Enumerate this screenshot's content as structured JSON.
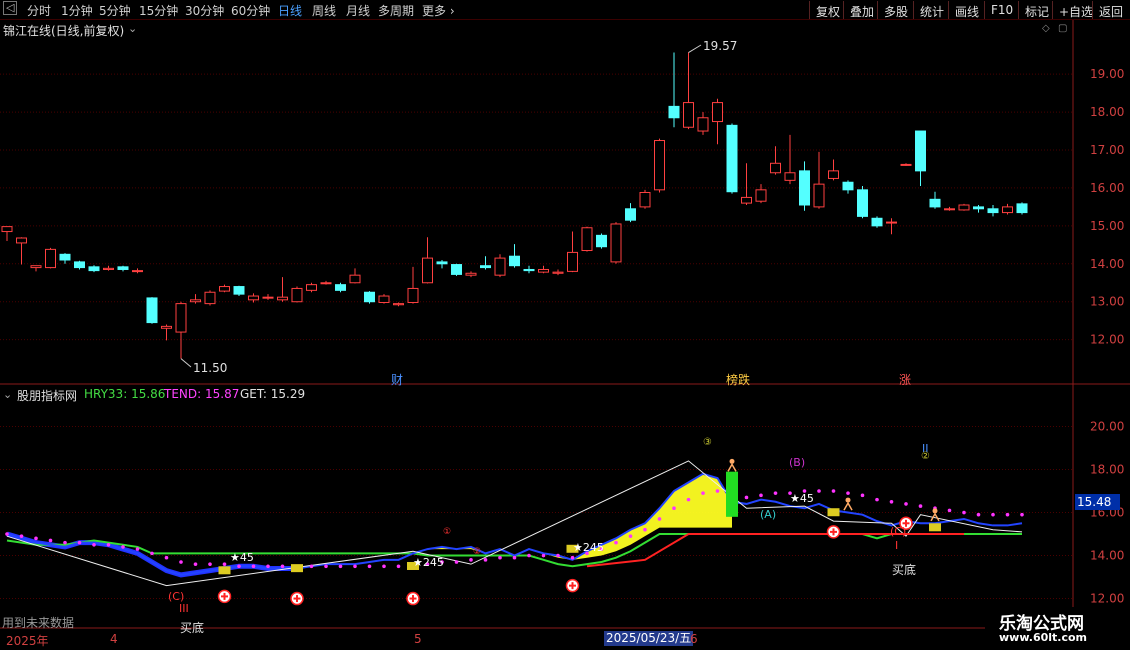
{
  "toolbar": {
    "left_items": [
      "分时",
      "1分钟",
      "5分钟",
      "15分钟",
      "30分钟",
      "60分钟",
      "日线",
      "周线",
      "月线",
      "多周期",
      "更多"
    ],
    "active_index": 6,
    "right_items": [
      "复权",
      "叠加",
      "多股",
      "统计",
      "画线",
      "F10",
      "标记",
      "+自选",
      "返回"
    ]
  },
  "main_panel": {
    "title": "锦江在线(日线,前复权)",
    "high_label": "19.57",
    "low_label": "11.50",
    "event_tags": [
      "财",
      "榜跌",
      "涨"
    ]
  },
  "indicator_panel": {
    "name": "股朋指标网",
    "hry_label": "HRY33:",
    "hry_value": "15.86",
    "tend_label": "TEND:",
    "tend_value": "15.87",
    "get_label": "GET:",
    "get_value": "15.29",
    "current_value": "15.48",
    "annotations": {
      "c_left": "(C)",
      "iii": "III",
      "buy_left": "买底",
      "c_right": "(C)",
      "i": "I",
      "buy_right": "买底",
      "a": "(A)",
      "b": "(B)",
      "ii": "II",
      "star_245": "★245",
      "star_45": "★45",
      "circle_1": "①",
      "circle_2": "②",
      "circle_3": "③"
    },
    "footer_note": "用到未来数据"
  },
  "date_axis": {
    "year": "2025年",
    "month_4": "4",
    "month_5": "5",
    "cursor_date": "2025/05/23/五",
    "month_6": "6"
  },
  "watermark": {
    "line1": "乐淘公式网",
    "line2": "www.60lt.com"
  },
  "colors": {
    "up": "#ff4040",
    "down": "#54ffff",
    "grid": "#4a0000",
    "axis_text": "#d04040"
  },
  "chart_data": [
    {
      "type": "candlestick",
      "title": "锦江在线(日线,前复权)",
      "ylim": [
        11.2,
        19.9
      ],
      "y_ticks": [
        12.0,
        13.0,
        14.0,
        15.0,
        16.0,
        17.0,
        18.0,
        19.0
      ],
      "candles": [
        [
          14.85,
          14.98,
          14.9,
          14.6
        ],
        [
          14.55,
          14.68,
          14.7,
          13.98
        ],
        [
          13.9,
          13.95,
          13.92,
          13.8
        ],
        [
          13.9,
          14.38,
          14.42,
          13.88
        ],
        [
          14.25,
          14.1,
          14.28,
          14.0
        ],
        [
          14.05,
          13.9,
          14.08,
          13.85
        ],
        [
          13.92,
          13.82,
          13.96,
          13.78
        ],
        [
          13.85,
          13.88,
          13.95,
          13.82
        ],
        [
          13.92,
          13.85,
          13.95,
          13.8
        ],
        [
          13.8,
          13.82,
          13.88,
          13.75
        ],
        [
          13.1,
          12.45,
          13.12,
          12.42
        ],
        [
          12.3,
          12.35,
          12.4,
          11.98
        ],
        [
          12.2,
          12.95,
          13.0,
          11.5
        ],
        [
          13.0,
          13.05,
          13.2,
          12.95
        ],
        [
          12.95,
          13.25,
          13.3,
          12.9
        ],
        [
          13.28,
          13.4,
          13.45,
          13.25
        ],
        [
          13.4,
          13.2,
          13.42,
          13.15
        ],
        [
          13.05,
          13.15,
          13.22,
          12.98
        ],
        [
          13.1,
          13.12,
          13.2,
          13.05
        ],
        [
          13.05,
          13.12,
          13.65,
          13.0
        ],
        [
          13.0,
          13.35,
          13.4,
          12.98
        ],
        [
          13.3,
          13.45,
          13.5,
          13.25
        ],
        [
          13.48,
          13.5,
          13.55,
          13.45
        ],
        [
          13.45,
          13.3,
          13.5,
          13.25
        ],
        [
          13.5,
          13.7,
          13.88,
          13.48
        ],
        [
          13.25,
          13.0,
          13.28,
          12.95
        ],
        [
          12.98,
          13.15,
          13.2,
          12.95
        ],
        [
          12.92,
          12.95,
          12.98,
          12.88
        ],
        [
          12.98,
          13.35,
          13.92,
          12.95
        ],
        [
          13.5,
          14.15,
          14.7,
          13.48
        ],
        [
          14.05,
          14.0,
          14.1,
          13.88
        ],
        [
          13.98,
          13.72,
          14.0,
          13.68
        ],
        [
          13.7,
          13.75,
          13.8,
          13.65
        ],
        [
          13.95,
          13.9,
          14.2,
          13.85
        ],
        [
          13.7,
          14.15,
          14.25,
          13.65
        ],
        [
          14.2,
          13.95,
          14.52,
          13.9
        ],
        [
          13.85,
          13.82,
          13.95,
          13.75
        ],
        [
          13.78,
          13.85,
          13.95,
          13.75
        ],
        [
          13.75,
          13.78,
          13.85,
          13.7
        ],
        [
          13.8,
          14.3,
          14.85,
          13.78
        ],
        [
          14.35,
          14.95,
          14.98,
          14.32
        ],
        [
          14.75,
          14.45,
          14.8,
          14.4
        ],
        [
          14.05,
          15.05,
          15.1,
          14.0
        ],
        [
          15.45,
          15.15,
          15.6,
          15.1
        ],
        [
          15.5,
          15.88,
          15.95,
          15.45
        ],
        [
          15.95,
          17.25,
          17.3,
          15.88
        ],
        [
          18.15,
          17.85,
          19.57,
          17.6
        ],
        [
          17.6,
          18.25,
          19.57,
          17.55
        ],
        [
          17.5,
          17.85,
          18.0,
          17.4
        ],
        [
          17.75,
          18.25,
          18.35,
          17.15
        ],
        [
          17.65,
          15.9,
          17.7,
          15.85
        ],
        [
          15.6,
          15.75,
          16.65,
          15.55
        ],
        [
          15.65,
          15.95,
          16.1,
          15.6
        ],
        [
          16.4,
          16.65,
          17.1,
          16.35
        ],
        [
          16.2,
          16.4,
          17.4,
          16.1
        ],
        [
          16.45,
          15.55,
          16.7,
          15.4
        ],
        [
          15.5,
          16.1,
          16.95,
          15.45
        ],
        [
          16.25,
          16.45,
          16.75,
          16.2
        ],
        [
          16.15,
          15.95,
          16.2,
          15.85
        ],
        [
          15.95,
          15.25,
          16.05,
          15.2
        ],
        [
          15.2,
          15.0,
          15.25,
          14.95
        ],
        [
          15.08,
          15.1,
          15.2,
          14.78
        ],
        [
          16.6,
          16.62,
          16.65,
          16.58
        ],
        [
          17.5,
          16.45,
          17.5,
          16.05
        ],
        [
          15.7,
          15.5,
          15.9,
          15.45
        ],
        [
          15.45,
          15.45,
          15.5,
          15.4
        ],
        [
          15.42,
          15.55,
          15.58,
          15.4
        ],
        [
          15.5,
          15.45,
          15.55,
          15.35
        ],
        [
          15.45,
          15.35,
          15.55,
          15.25
        ],
        [
          15.35,
          15.5,
          15.58,
          15.3
        ],
        [
          15.58,
          15.35,
          15.62,
          15.3
        ]
      ]
    },
    {
      "type": "line",
      "title": "股朋指标网",
      "ylim": [
        11.7,
        21.0
      ],
      "y_ticks": [
        12.0,
        14.0,
        16.0,
        18.0,
        20.0
      ],
      "series": [
        {
          "name": "HRY33",
          "values": [
            15.0,
            14.8,
            14.6,
            14.5,
            14.4,
            14.6,
            14.6,
            14.5,
            14.3,
            14.1,
            13.7,
            13.3,
            13.1,
            13.2,
            13.3,
            13.4,
            13.5,
            13.5,
            13.4,
            13.4,
            13.4,
            13.5,
            13.6,
            13.6,
            13.6,
            13.7,
            13.8,
            13.8,
            14.1,
            14.3,
            14.4,
            14.3,
            14.4,
            14.1,
            14.3,
            14.0,
            14.3,
            14.1,
            14.0,
            13.8,
            14.2,
            14.5,
            14.8,
            15.2,
            15.5,
            16.2,
            17.0,
            17.4,
            17.8,
            17.6,
            16.5,
            16.4,
            16.6,
            16.5,
            16.3,
            16.2,
            16.4,
            16.1,
            16.0,
            15.9,
            15.6,
            15.4,
            15.6,
            15.5,
            15.5,
            15.6,
            15.7,
            15.5,
            15.4,
            15.4,
            15.5
          ]
        },
        {
          "name": "TEND",
          "values": [
            15.0,
            14.9,
            14.8,
            14.7,
            14.6,
            14.6,
            14.5,
            14.5,
            14.4,
            14.3,
            14.1,
            13.9,
            13.7,
            13.6,
            13.6,
            13.6,
            13.5,
            13.5,
            13.5,
            13.5,
            13.5,
            13.5,
            13.5,
            13.5,
            13.5,
            13.5,
            13.5,
            13.5,
            13.6,
            13.6,
            13.7,
            13.7,
            13.8,
            13.8,
            13.9,
            13.9,
            14.0,
            14.0,
            14.0,
            13.9,
            14.1,
            14.3,
            14.6,
            14.9,
            15.2,
            15.7,
            16.2,
            16.6,
            16.9,
            17.0,
            16.8,
            16.7,
            16.8,
            16.9,
            16.9,
            17.0,
            17.0,
            17.0,
            16.9,
            16.8,
            16.6,
            16.5,
            16.4,
            16.3,
            16.2,
            16.1,
            16.0,
            15.9,
            15.9,
            15.9,
            15.9
          ]
        },
        {
          "name": "GET",
          "values": [
            14.7,
            14.6,
            14.5,
            14.5,
            14.5,
            14.6,
            14.7,
            14.6,
            14.5,
            14.4,
            14.1,
            14.1,
            14.1,
            14.1,
            14.1,
            14.1,
            14.1,
            14.1,
            14.1,
            14.1,
            14.1,
            14.1,
            14.1,
            14.1,
            14.1,
            14.1,
            14.1,
            14.1,
            14.1,
            14.0,
            14.0,
            14.0,
            14.0,
            14.0,
            14.0,
            14.0,
            14.0,
            13.8,
            13.6,
            13.5,
            13.6,
            13.7,
            13.9,
            14.2,
            14.6,
            15.0,
            15.0,
            15.0,
            15.0,
            15.0,
            15.0,
            15.0,
            15.0,
            15.0,
            15.0,
            15.0,
            15.0,
            15.0,
            15.0,
            15.0,
            14.8,
            15.0,
            15.0,
            15.0,
            15.0,
            15.0,
            15.0,
            15.0,
            15.0,
            15.0,
            15.0
          ]
        }
      ]
    }
  ]
}
